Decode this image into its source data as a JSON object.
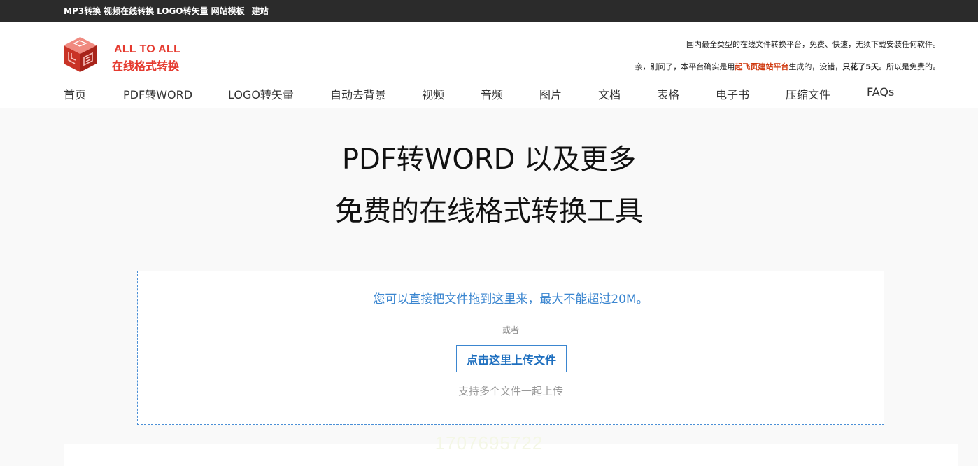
{
  "topbar": {
    "links": [
      "MP3转换",
      "视频在线转换",
      "LOGO转矢量",
      "网站模板",
      "建站"
    ]
  },
  "brand": {
    "name_en": "ALL TO ALL",
    "name_cn": "在线格式转换",
    "color": "#e53a2f",
    "logo_icon": "cube-logo-icon"
  },
  "tagline": {
    "line1": "国内最全类型的在线文件转换平台，免费、快速，无须下载安装任何软件。",
    "line2_a": "亲，别问了，本平台确实是用",
    "line2_link": "起飞页建站平台",
    "line2_b": "生成的，没错，",
    "line2_bold": "只花了5天",
    "line2_c": "。所以是免费的。"
  },
  "nav": [
    "首页",
    "PDF转WORD",
    "LOGO转矢量",
    "自动去背景",
    "视频",
    "音频",
    "图片",
    "文档",
    "表格",
    "电子书",
    "压缩文件",
    "FAQs"
  ],
  "hero": {
    "line1": "PDF转WORD 以及更多",
    "line2": "免费的在线格式转换工具"
  },
  "upload": {
    "drop_hint": "您可以直接把文件拖到这里来，最大不能超过20M。",
    "or": "或者",
    "button": "点击这里上传文件",
    "multi_note": "支持多个文件一起上传",
    "accent_color": "#3b86d0"
  },
  "counter": "1707695722"
}
